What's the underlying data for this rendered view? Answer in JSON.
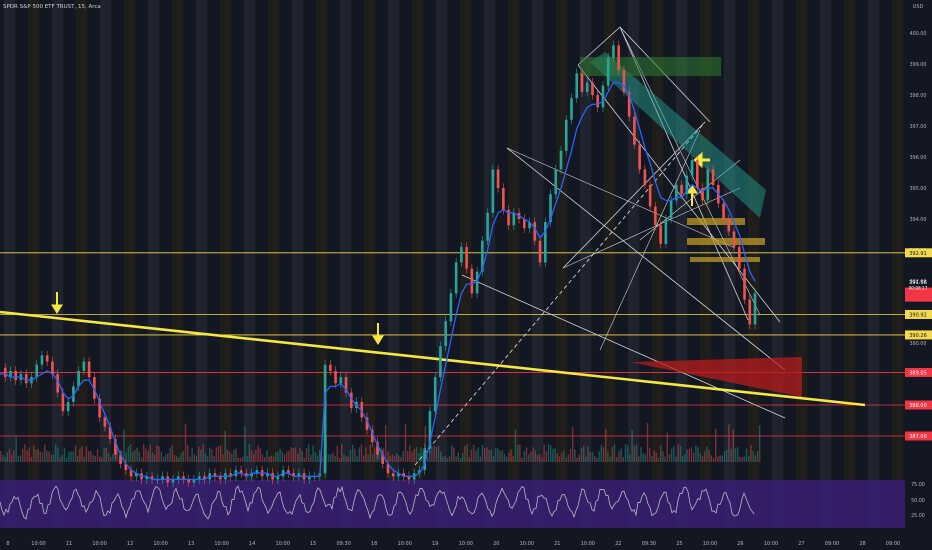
{
  "title": "SPDR S&P 500 ETF TRUST, 15, Arca",
  "currency": "USD",
  "chart_data": {
    "type": "line",
    "ylim": [
      385.5,
      401
    ],
    "price_ticks": [
      "400.00",
      "399.00",
      "398.00",
      "397.00",
      "396.00",
      "395.00",
      "394.00",
      "393.00",
      "392.00",
      "391.00",
      "390.00",
      "389.00",
      "388.00",
      "387.00",
      "386.00",
      "385.00"
    ],
    "x_ticks": [
      "8",
      "10:00",
      "11",
      "10:00",
      "12",
      "10:00",
      "13",
      "10:00",
      "14",
      "10:00",
      "15",
      "09:30",
      "18",
      "10:00",
      "19",
      "10:00",
      "20",
      "10:00",
      "21",
      "10:00",
      "22",
      "09:30",
      "25",
      "10:00",
      "26",
      "10:00",
      "27",
      "09:00",
      "28",
      "09:00"
    ],
    "horizontal_levels": [
      {
        "value": 392.91,
        "label": "392.91",
        "color": "#f2d94e"
      },
      {
        "value": 390.92,
        "label": "390.92",
        "color": "#f2d94e"
      },
      {
        "value": 390.26,
        "label": "390.26",
        "color": "#f2d94e"
      },
      {
        "value": 389.05,
        "label": "389.05",
        "color": "#f23645"
      },
      {
        "value": 388.0,
        "label": "388.00",
        "color": "#f23645"
      },
      {
        "value": 387.0,
        "label": "387.00",
        "color": "#f23645"
      }
    ],
    "last_price": {
      "value": "391.56",
      "sub": "00:08:17"
    },
    "oscillator": {
      "ticks": [
        "75.00",
        "50.00",
        "25.00"
      ]
    },
    "price": [
      389.2,
      388.9,
      389.1,
      388.8,
      389.0,
      388.7,
      388.9,
      389.3,
      389.6,
      389.4,
      389.0,
      388.4,
      387.8,
      388.1,
      388.6,
      389.1,
      389.4,
      388.9,
      388.2,
      387.6,
      387.3,
      386.9,
      386.4,
      386.1,
      385.9,
      385.7,
      385.8,
      385.6,
      385.7,
      385.6,
      385.6,
      385.7,
      385.5,
      385.6,
      385.7,
      385.6,
      385.5,
      385.6,
      385.7,
      385.6,
      385.8,
      385.7,
      385.6,
      385.8,
      385.7,
      385.9,
      385.8,
      385.7,
      385.8,
      385.9,
      385.7,
      385.8,
      385.6,
      385.7,
      385.9,
      385.8,
      385.7,
      385.8,
      385.6,
      385.7,
      385.7,
      385.8,
      389.3,
      389.1,
      388.7,
      388.9,
      388.4,
      387.9,
      388.1,
      387.6,
      387.2,
      386.8,
      386.4,
      386.1,
      385.8,
      385.7,
      385.8,
      385.7,
      385.6,
      385.8,
      385.9,
      386.6,
      387.8,
      388.9,
      389.9,
      390.7,
      391.6,
      392.6,
      393.1,
      392.4,
      391.6,
      392.3,
      393.3,
      394.2,
      395.6,
      395.0,
      394.3,
      393.8,
      394.2,
      394.0,
      393.7,
      393.9,
      393.3,
      392.6,
      393.9,
      394.8,
      395.6,
      396.2,
      397.2,
      397.9,
      398.7,
      398.1,
      398.4,
      398.0,
      397.6,
      398.3,
      399.2,
      399.6,
      398.8,
      398.1,
      397.3,
      396.4,
      395.6,
      395.1,
      394.4,
      393.8,
      393.2,
      394.0,
      394.6,
      395.1,
      394.8,
      395.4,
      395.9,
      395.0,
      394.6,
      395.6,
      395.1,
      394.5,
      394.0,
      393.6,
      393.1,
      392.4,
      391.4,
      390.6,
      391.6
    ],
    "ma": [
      389.0,
      389.0,
      388.9,
      388.9,
      388.9,
      388.8,
      388.8,
      388.9,
      389.0,
      389.1,
      389.0,
      388.8,
      388.4,
      388.2,
      388.3,
      388.6,
      388.8,
      388.8,
      388.5,
      388.1,
      387.7,
      387.3,
      386.8,
      386.4,
      386.1,
      385.9,
      385.8,
      385.7,
      385.7,
      385.6,
      385.6,
      385.6,
      385.6,
      385.6,
      385.6,
      385.6,
      385.6,
      385.6,
      385.6,
      385.6,
      385.7,
      385.7,
      385.7,
      385.7,
      385.7,
      385.8,
      385.8,
      385.7,
      385.8,
      385.8,
      385.8,
      385.8,
      385.7,
      385.7,
      385.8,
      385.8,
      385.7,
      385.7,
      385.7,
      385.7,
      385.7,
      385.7,
      388.4,
      388.6,
      388.6,
      388.7,
      388.5,
      388.2,
      388.0,
      387.8,
      387.5,
      387.1,
      386.7,
      386.4,
      386.1,
      385.9,
      385.8,
      385.7,
      385.7,
      385.7,
      385.8,
      386.1,
      386.8,
      387.6,
      388.5,
      389.3,
      390.1,
      390.9,
      391.6,
      391.9,
      391.9,
      392.0,
      392.4,
      393.0,
      393.8,
      394.2,
      394.3,
      394.2,
      394.2,
      394.1,
      394.0,
      393.9,
      393.7,
      393.4,
      393.6,
      394.0,
      394.5,
      395.0,
      395.6,
      396.2,
      396.9,
      397.3,
      397.6,
      397.7,
      397.7,
      397.8,
      398.1,
      398.4,
      398.4,
      398.3,
      398.0,
      397.5,
      396.9,
      396.3,
      395.8,
      395.2,
      394.7,
      394.6,
      394.6,
      394.7,
      394.7,
      394.9,
      395.1,
      395.0,
      394.9,
      395.0,
      395.0,
      394.8,
      394.6,
      394.3,
      393.9,
      393.5,
      392.9,
      392.3,
      392.0
    ]
  }
}
